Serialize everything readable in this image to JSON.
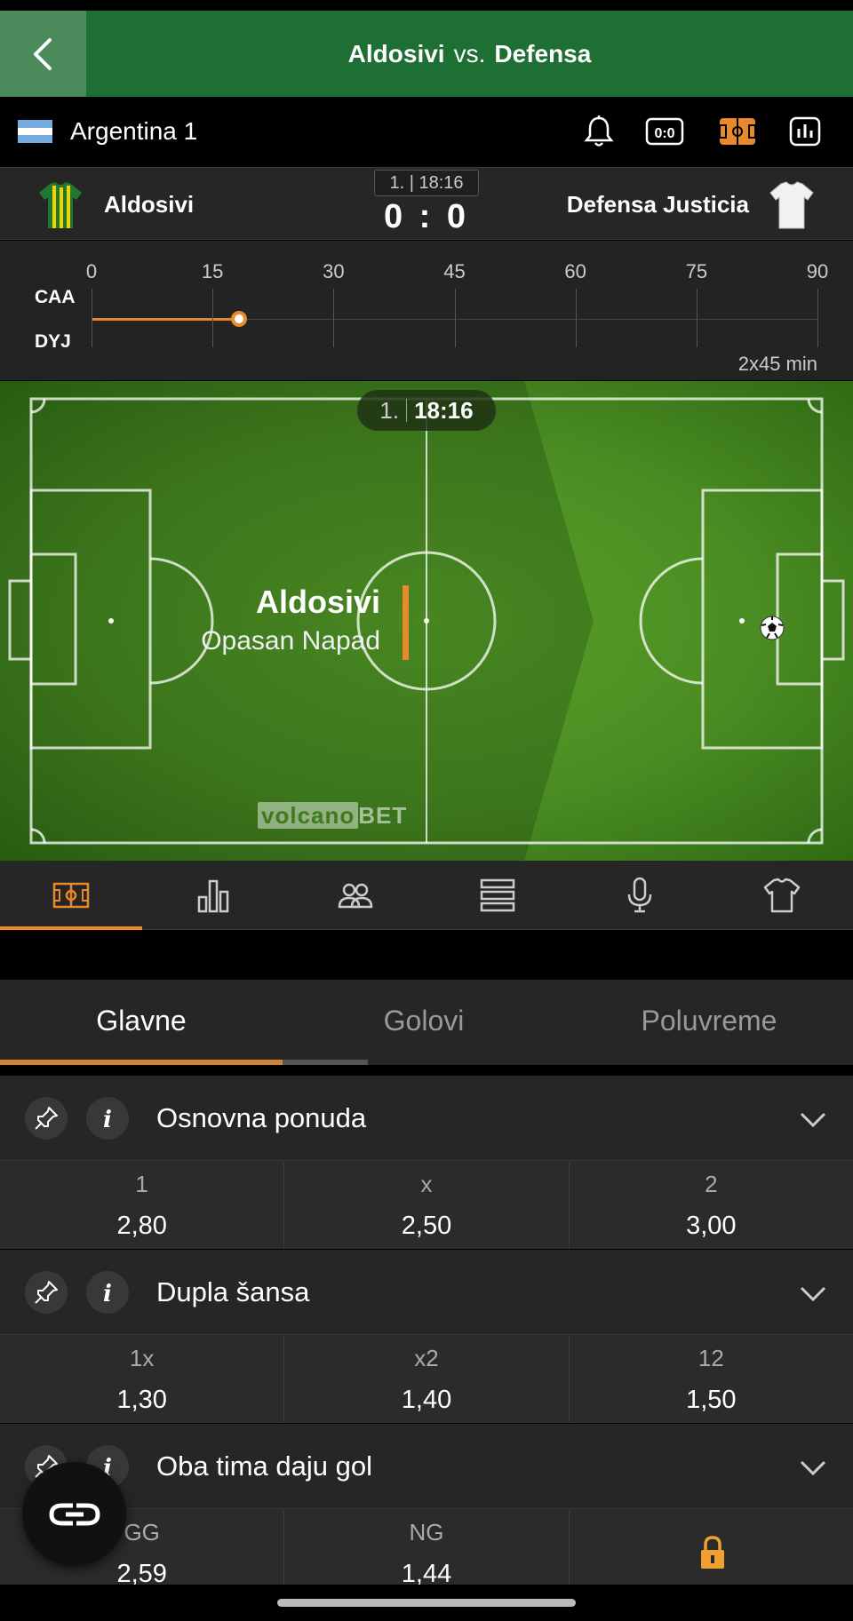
{
  "header": {
    "home_team": "Aldosivi",
    "vs": "vs.",
    "away_team": "Defensa"
  },
  "league": {
    "name": "Argentina 1"
  },
  "scoreboard": {
    "home_name": "Aldosivi",
    "away_name": "Defensa Justicia",
    "period_time": "1. | 18:16",
    "score": "0 : 0"
  },
  "timeline": {
    "ticks": [
      "0",
      "15",
      "30",
      "45",
      "60",
      "75",
      "90"
    ],
    "home_abbr": "CAA",
    "away_abbr": "DYJ",
    "elapsed_minute": 18.27,
    "duration": "2x45 min"
  },
  "pitch": {
    "period": "1.",
    "clock": "18:16",
    "event_team": "Aldosivi",
    "event_desc": "Opasan Napad",
    "watermark_a": "volcano",
    "watermark_b": "BET"
  },
  "pitch_tabs": [
    "pitch-icon",
    "stats-icon",
    "lineups-icon",
    "table-icon",
    "commentary-icon",
    "jersey-icon"
  ],
  "market_tabs": {
    "main": "Glavne",
    "goals": "Golovi",
    "half": "Poluvreme"
  },
  "markets": [
    {
      "title": "Osnovna ponuda",
      "odds": [
        {
          "label": "1",
          "value": "2,80"
        },
        {
          "label": "x",
          "value": "2,50"
        },
        {
          "label": "2",
          "value": "3,00"
        }
      ]
    },
    {
      "title": "Dupla šansa",
      "odds": [
        {
          "label": "1x",
          "value": "1,30"
        },
        {
          "label": "x2",
          "value": "1,40"
        },
        {
          "label": "12",
          "value": "1,50"
        }
      ]
    },
    {
      "title": "Oba tima daju gol",
      "odds": [
        {
          "label": "GG",
          "value": "2,59"
        },
        {
          "label": "NG",
          "value": "1,44"
        }
      ],
      "locked_third": true
    }
  ],
  "colors": {
    "header_green": "#1e6f34",
    "accent_orange": "#e8892b",
    "panel": "#262626"
  }
}
